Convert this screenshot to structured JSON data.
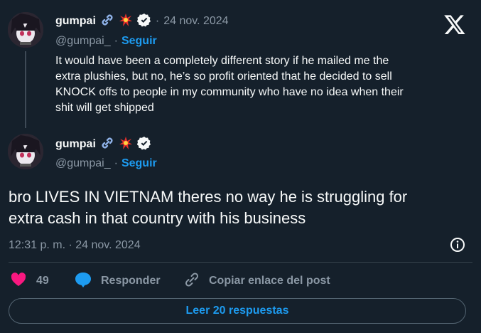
{
  "close_label": "X",
  "reply_tweet": {
    "name": "gumpai",
    "name_icons": [
      "link-icon",
      "explosion-icon",
      "verified-badge-icon"
    ],
    "date": "24 nov. 2024",
    "handle": "@gumpai_",
    "separator": "·",
    "follow_label": "Seguir",
    "text_lines": [
      "It would have been a completely different story if he mailed me the",
      "extra plushies, but no, he’s so profit oriented that he decided to sell",
      "KNOCK offs to people in my community who have no idea when their",
      "shit will get shipped"
    ]
  },
  "main_tweet": {
    "name": "gumpai",
    "handle": "@gumpai_",
    "separator": "·",
    "follow_label": "Seguir",
    "text_lines": [
      "bro LIVES IN VIETNAM theres no way he is struggling for",
      "extra cash in that country with his business"
    ],
    "timestamp": "12:31 p. m. · 24 nov. 2024"
  },
  "actions": {
    "likes_count": "49",
    "reply_label": "Responder",
    "copy_link_label": "Copiar enlace del post"
  },
  "read_replies_label": "Leer 20 respuestas",
  "colors": {
    "background": "#15202b",
    "accent": "#1d9bf0",
    "like": "#f91880",
    "muted": "#8b98a5"
  }
}
